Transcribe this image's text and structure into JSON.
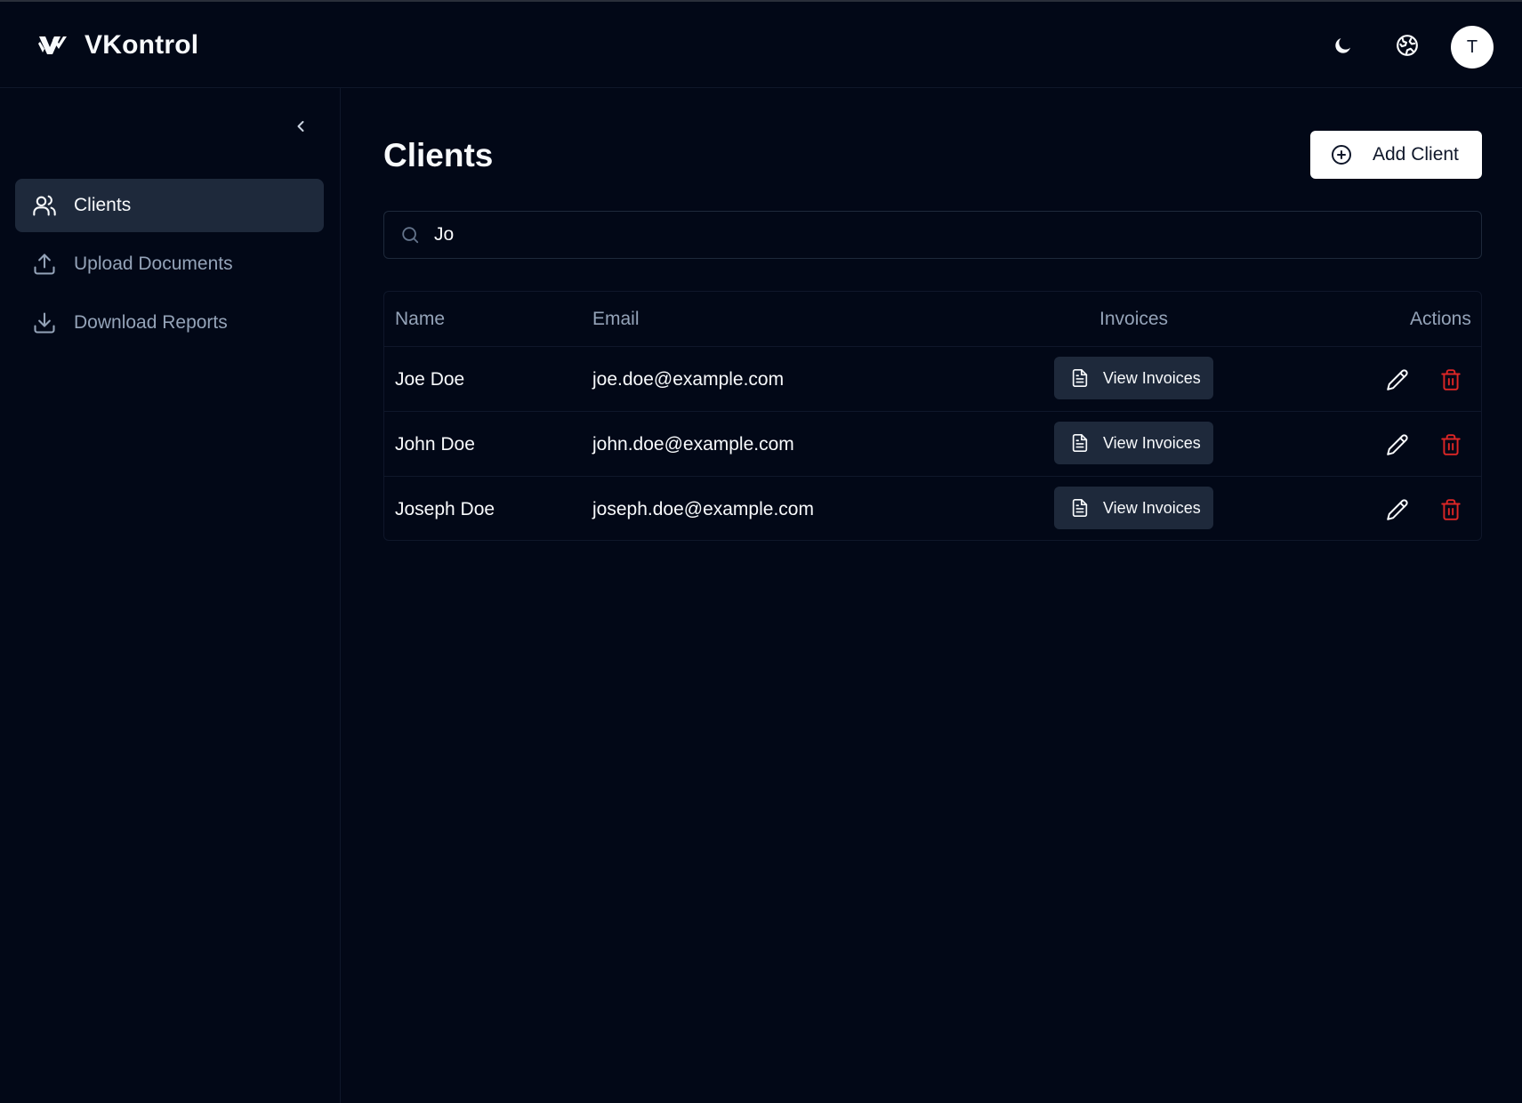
{
  "app": {
    "name": "VKontrol"
  },
  "header": {
    "theme_toggle_icon": "moon-icon",
    "language_icon": "globe-icon",
    "avatar_initial": "T"
  },
  "sidebar": {
    "collapse_icon": "chevron-left-icon",
    "items": [
      {
        "label": "Clients",
        "icon": "users-icon",
        "active": true
      },
      {
        "label": "Upload Documents",
        "icon": "upload-icon",
        "active": false
      },
      {
        "label": "Download Reports",
        "icon": "download-icon",
        "active": false
      }
    ]
  },
  "main": {
    "title": "Clients",
    "add_button_label": "Add Client",
    "search": {
      "value": "Jo",
      "placeholder": ""
    },
    "table": {
      "columns": [
        "Name",
        "Email",
        "Invoices",
        "Actions"
      ],
      "rows": [
        {
          "name": "Joe Doe",
          "email": "joe.doe@example.com",
          "invoice_button": "View Invoices"
        },
        {
          "name": "John Doe",
          "email": "john.doe@example.com",
          "invoice_button": "View Invoices"
        },
        {
          "name": "Joseph Doe",
          "email": "joseph.doe@example.com",
          "invoice_button": "View Invoices"
        }
      ]
    }
  },
  "colors": {
    "background": "#020817",
    "surface": "#1e293b",
    "muted_text": "#94a3b8",
    "text": "#f8fafc",
    "danger": "#dc2626"
  }
}
